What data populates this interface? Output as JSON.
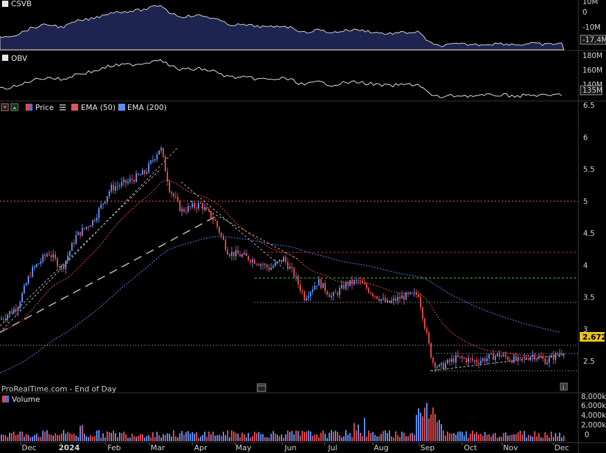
{
  "panels": {
    "csvb": {
      "name": "CSVB",
      "ticks": [
        "10M",
        "0",
        "-10M"
      ],
      "last_value": "-17.4M"
    },
    "obv": {
      "name": "OBV",
      "ticks": [
        "180M",
        "160M",
        "140M"
      ],
      "last_value": "135M"
    },
    "price": {
      "legend": [
        {
          "label": "Price",
          "color": "#4d6ed6"
        },
        {
          "label": "EMA (50)",
          "color": "#e05555"
        },
        {
          "label": "EMA (200)",
          "color": "#5b8ef0"
        }
      ],
      "ticks": [
        "6.5",
        "6",
        "5.5",
        "5",
        "4.5",
        "4",
        "3.5",
        "3",
        "2.5"
      ],
      "last_price": "2.672",
      "footer": "ProRealTime.com - End of Day",
      "colors": {
        "up": "#5b8ef0",
        "down": "#e04848",
        "ema50": "#d84a4a",
        "ema200": "#4f86e6"
      }
    },
    "volume": {
      "name": "Volume",
      "ticks": [
        "8,000k",
        "6,000k",
        "4,000k",
        "2,000k",
        "0"
      ]
    }
  },
  "x_axis": {
    "months": [
      "Dec",
      "2024",
      "Feb",
      "Mar",
      "Apr",
      "May",
      "Jun",
      "Jul",
      "Aug",
      "Sep",
      "Oct",
      "Nov",
      "Dec"
    ]
  },
  "chart_data": {
    "type": "line",
    "title": "",
    "ylim": [
      2.2,
      6.5
    ],
    "x": [
      "Dec",
      "2024",
      "Feb",
      "Mar",
      "Apr",
      "May",
      "Jun",
      "Jul",
      "Aug",
      "Sep",
      "Oct",
      "Nov",
      "Dec"
    ],
    "series": [
      {
        "name": "Price",
        "values": [
          3.3,
          3.9,
          5.0,
          5.6,
          4.9,
          4.1,
          3.85,
          3.6,
          3.55,
          2.45,
          2.55,
          2.6,
          2.67
        ]
      },
      {
        "name": "EMA (50)",
        "values": [
          3.0,
          3.5,
          4.4,
          5.1,
          4.95,
          4.4,
          4.0,
          3.75,
          3.55,
          3.3,
          2.85,
          2.7,
          2.67
        ]
      },
      {
        "name": "EMA (200)",
        "values": [
          2.35,
          2.7,
          3.05,
          3.45,
          3.75,
          3.97,
          3.95,
          3.85,
          3.8,
          3.7,
          3.5,
          3.35,
          3.25
        ]
      }
    ],
    "horizontal_levels": [
      5.0,
      4.2,
      3.8,
      3.42,
      2.75,
      2.62,
      2.35
    ],
    "last_price": 2.672,
    "volume_ylim": [
      0,
      8000
    ]
  }
}
